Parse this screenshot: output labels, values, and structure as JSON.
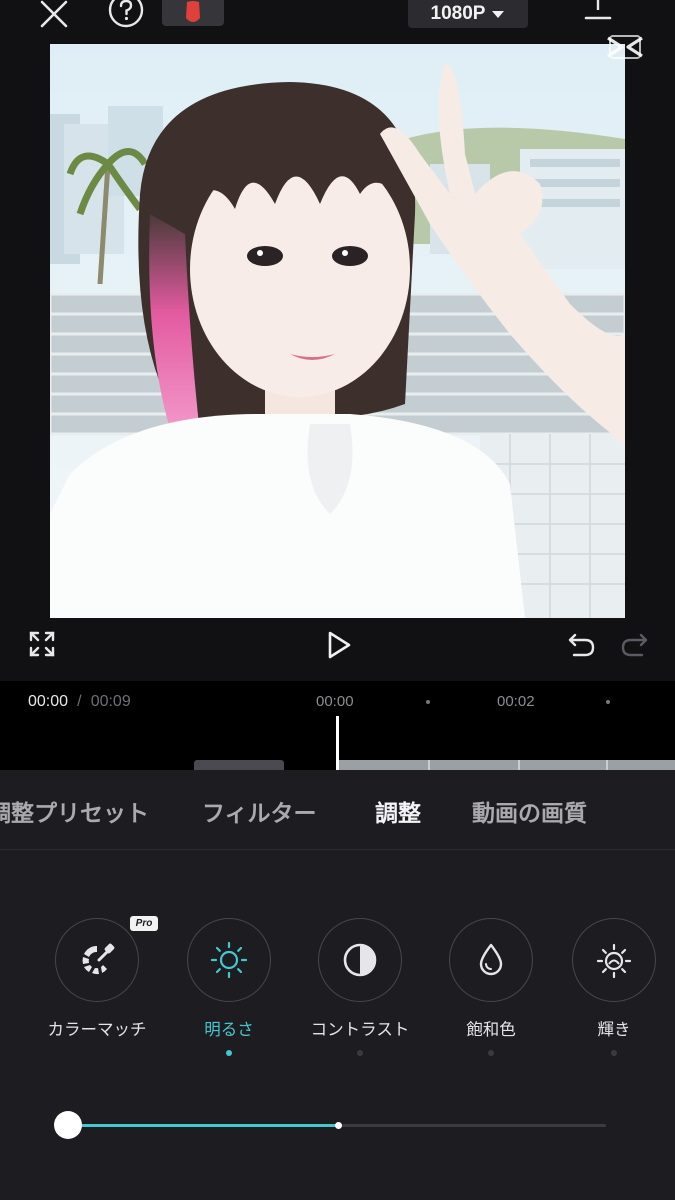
{
  "toolbar": {
    "close_icon": "close-icon",
    "help_icon": "help-icon",
    "record_icon": "record-icon",
    "resolution_label": "1080P",
    "export_icon": "export-icon",
    "brand_icon": "capcut-logo"
  },
  "playback": {
    "fullscreen_icon": "fullscreen-icon",
    "play_icon": "play-icon",
    "undo_icon": "undo-icon",
    "redo_icon": "redo-icon"
  },
  "timeline": {
    "current_time": "00:00",
    "separator": "/",
    "total_time": "00:09",
    "ticks": [
      "00:00",
      "00:02"
    ]
  },
  "tabs": [
    {
      "label": "調整プリセット",
      "active": false
    },
    {
      "label": "フィルター",
      "active": false
    },
    {
      "label": "調整",
      "active": true
    },
    {
      "label": "動画の画質",
      "active": false
    }
  ],
  "tools": [
    {
      "label": "カラーマッチ",
      "icon": "color-match-icon",
      "badge": "Pro",
      "active": false
    },
    {
      "label": "明るさ",
      "icon": "brightness-icon",
      "active": true
    },
    {
      "label": "コントラスト",
      "icon": "contrast-icon",
      "active": false
    },
    {
      "label": "飽和色",
      "icon": "saturation-icon",
      "active": false
    },
    {
      "label": "輝き",
      "icon": "brilliance-icon",
      "active": false
    }
  ],
  "slider": {
    "value_fraction": 0.0,
    "accent": "#45c7cf"
  },
  "colors": {
    "accent": "#45c7cf",
    "panel_bg": "#1d1d21",
    "record_red": "#e0403a"
  }
}
